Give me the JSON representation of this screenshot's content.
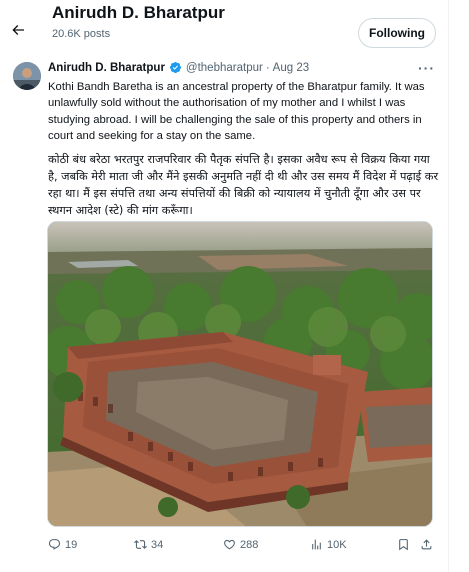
{
  "header": {
    "profile_name": "Anirudh D. Bharatpur",
    "post_count": "20.6K posts",
    "follow_label": "Following"
  },
  "tweet": {
    "author": "Anirudh D. Bharatpur",
    "handle": "@thebharatpur",
    "separator": "·",
    "date": "Aug 23",
    "text_en": "Kothi Bandh Baretha is an ancestral property of the Bharatpur family. It was unlawfully sold without the authorisation of my mother and I whilst I was studying abroad. I will be challenging the sale of this property and others in court and seeking for a stay on the same.",
    "text_hi": "कोठी बंध बरेठा भरतपुर राजपरिवार  की पैतृक संपत्ति है। इसका अवैध रूप से विक्रय किया गया है, जबकि मेरी माता जी और मैंने इसकी अनुमति नहीं दी थी और उस समय मैं विदेश में पढ़ाई कर रहा था। मैं इस संपत्ति तथा अन्य संपत्तियों की बिक्री को न्यायालय में चुनौती दूँगा और उस पर स्थगन आदेश (स्टे) की मांग करूँगा।",
    "more_label": "···"
  },
  "actions": {
    "replies": "19",
    "reposts": "34",
    "likes": "288",
    "views": "10K"
  },
  "colors": {
    "verified_blue": "#1d9bf0",
    "muted_text": "#536471",
    "border": "#cfd9de"
  }
}
